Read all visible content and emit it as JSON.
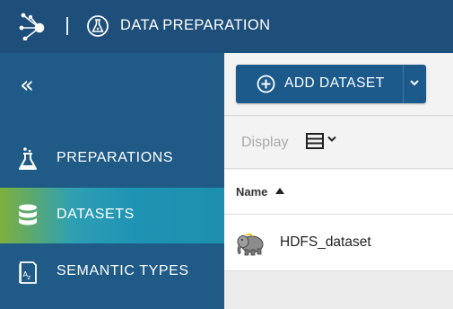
{
  "header": {
    "app_title": "DATA PREPARATION",
    "logo_icon": "network-logo-icon",
    "app_icon": "data-preparation-icon",
    "background_color": "#1e4f7a"
  },
  "sidebar": {
    "background_color": "#1f5b86",
    "collapse_icon": "double-chevron-left-icon",
    "items": [
      {
        "label": "PREPARATIONS",
        "icon": "flask-icon",
        "active": false
      },
      {
        "label": "DATASETS",
        "icon": "database-icon",
        "active": true
      },
      {
        "label": "SEMANTIC TYPES",
        "icon": "dictionary-icon",
        "active": false
      }
    ]
  },
  "toolbar": {
    "add_dataset_label": "ADD DATASET",
    "add_dataset_icon": "plus-circle-icon",
    "dropdown_icon": "chevron-down-icon",
    "button_color": "#1c5a8c"
  },
  "display": {
    "label": "Display",
    "mode_icon": "list-view-icon"
  },
  "table": {
    "columns": [
      {
        "label": "Name",
        "sort": "ascending"
      }
    ],
    "rows": [
      {
        "name": "HDFS_dataset",
        "icon": "hadoop-elephant-icon"
      }
    ]
  }
}
